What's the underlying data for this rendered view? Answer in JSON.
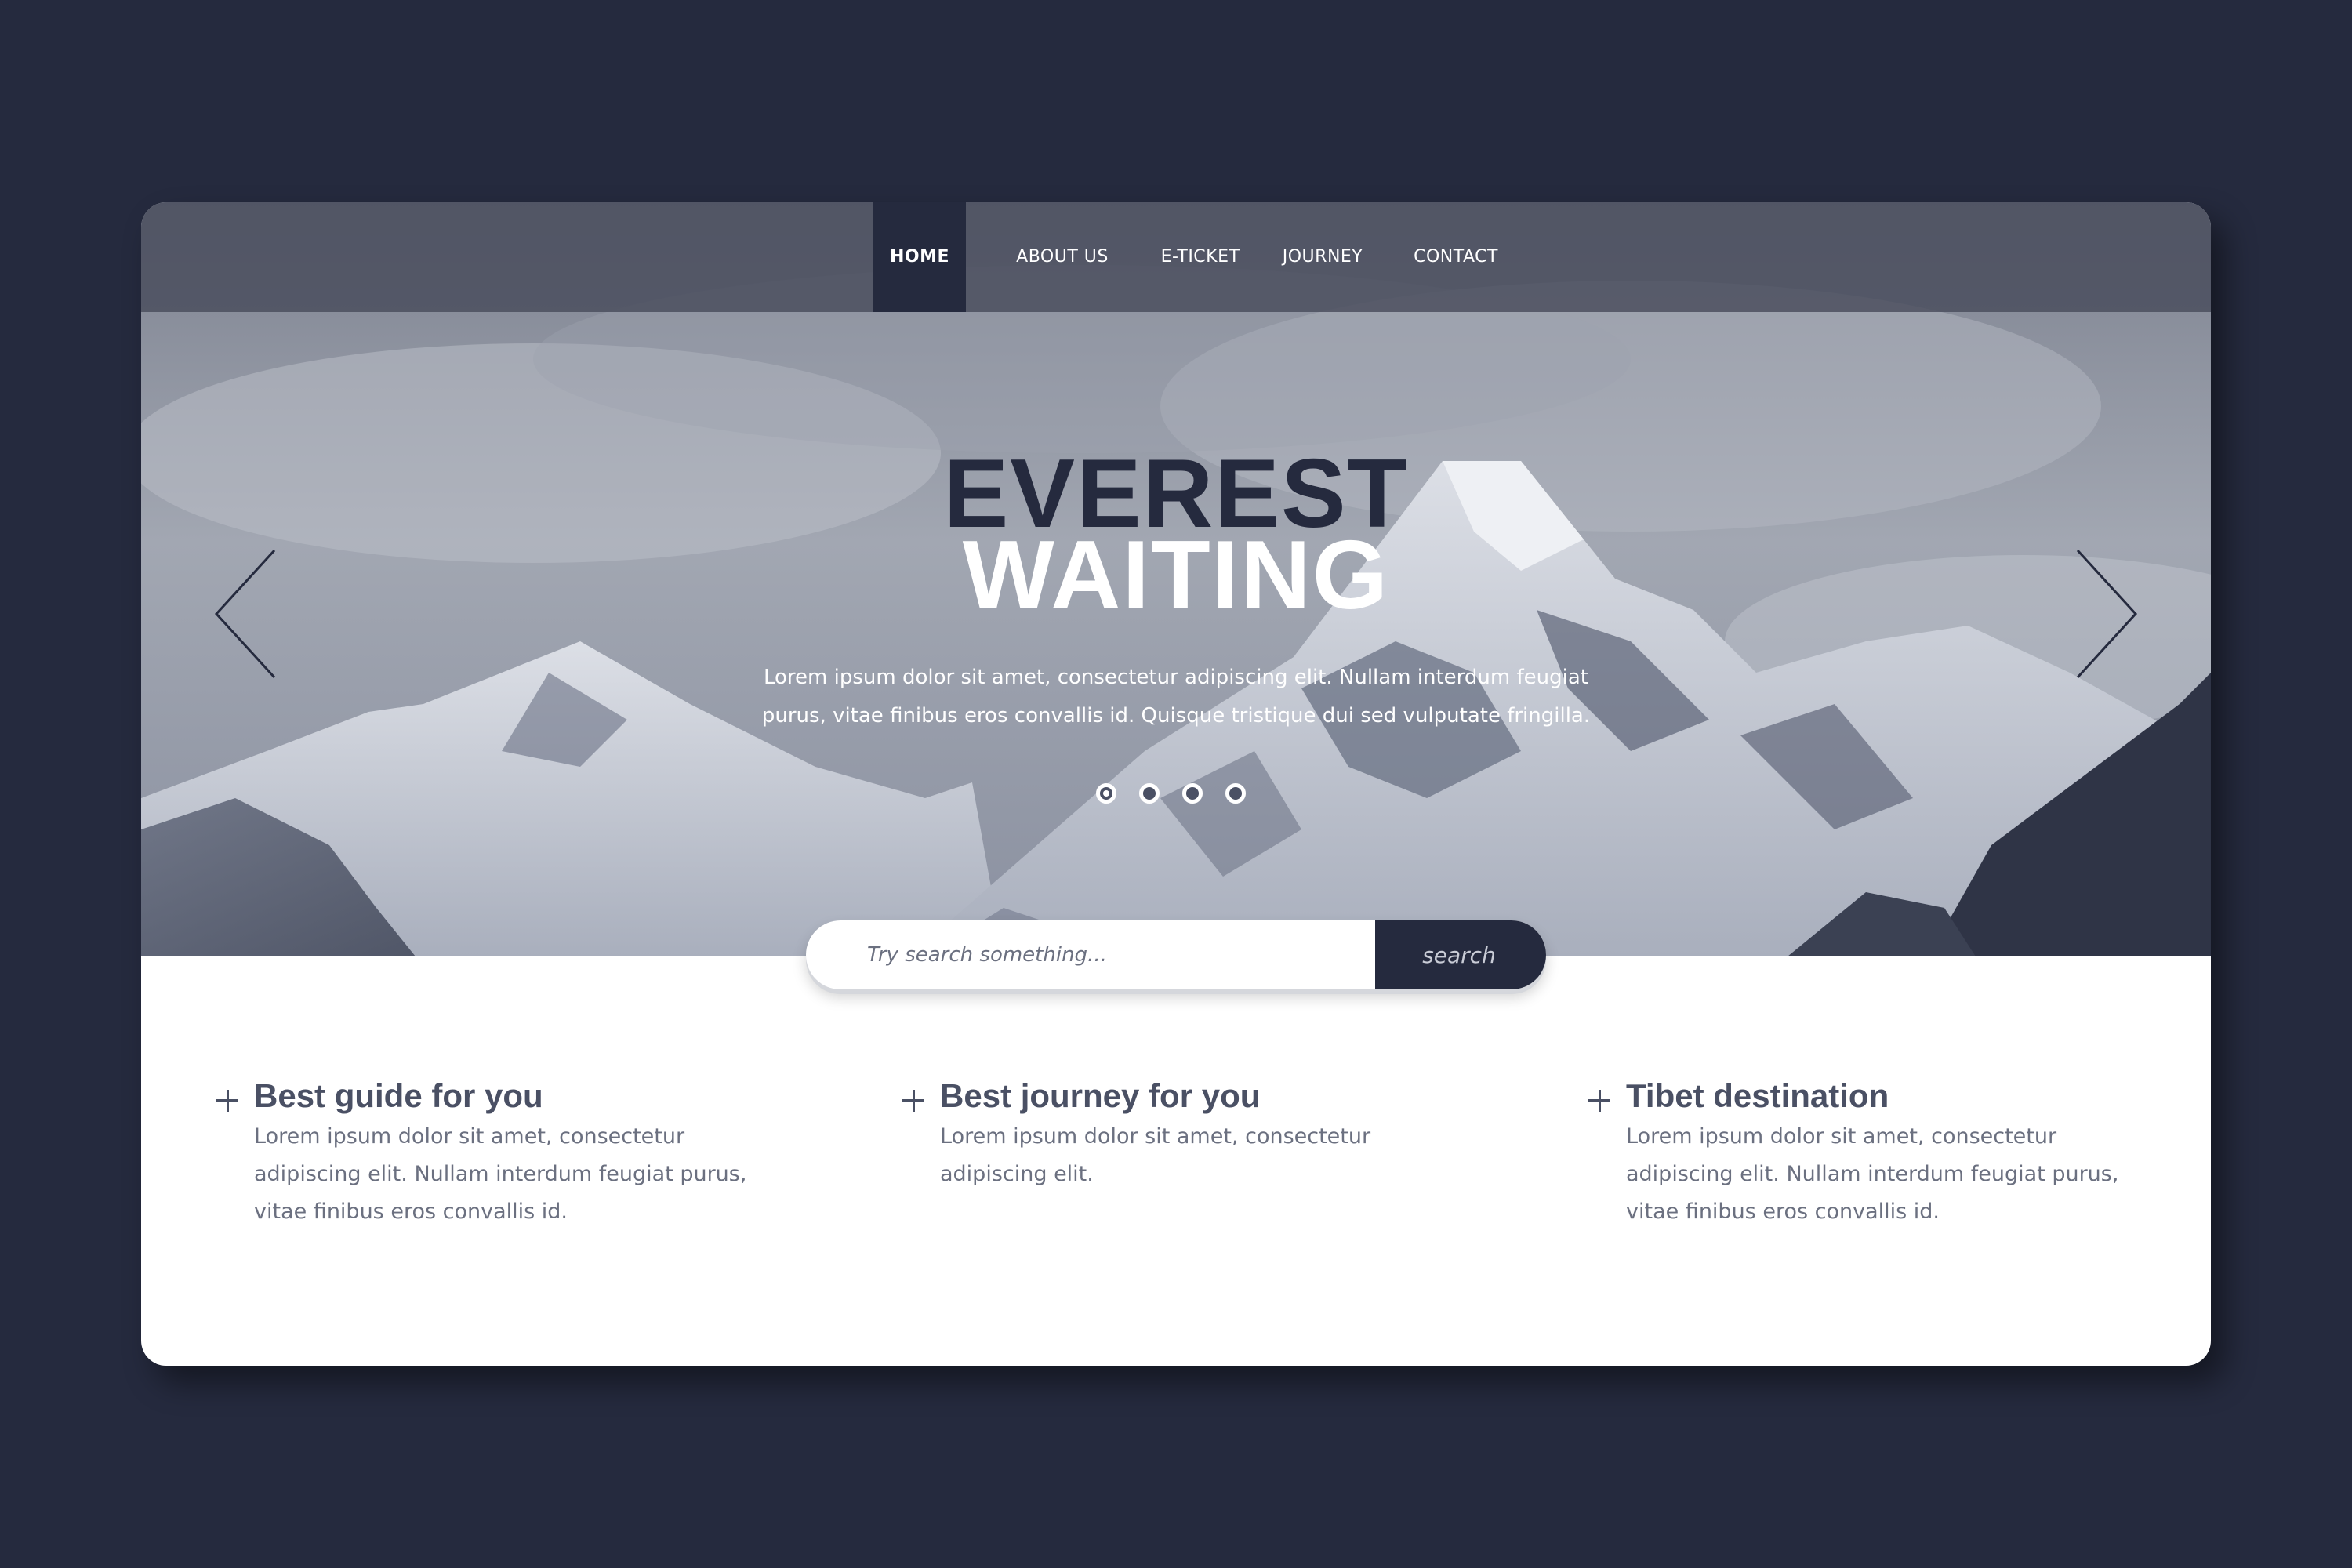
{
  "colors": {
    "page_background": "#252a3e",
    "accent_dark": "#252a3e",
    "nav_background": "#484c5c",
    "card_background": "#ffffff",
    "heading_text": "#4a5064",
    "body_text": "#6b7080"
  },
  "nav": {
    "items": [
      {
        "label": "HOME",
        "active": true
      },
      {
        "label": "ABOUT US",
        "active": false
      },
      {
        "label": "E-TICKET",
        "active": false
      },
      {
        "label": "JOURNEY",
        "active": false
      },
      {
        "label": "CONTACT",
        "active": false
      }
    ]
  },
  "hero": {
    "title_line_1": "EVEREST",
    "title_line_2": "WAITING",
    "description": "Lorem ipsum dolor sit amet, consectetur adipiscing elit. Nullam interdum feugiat purus, vitae finibus eros convallis id. Quisque tristique dui sed vulputate fringilla.",
    "prev_icon": "chevron-left-icon",
    "next_icon": "chevron-right-icon",
    "slide_count": 4,
    "active_slide": 1
  },
  "search": {
    "placeholder": "Try search something...",
    "value": "",
    "button_label": "search"
  },
  "features": [
    {
      "icon": "plus-icon",
      "title": "Best guide for you",
      "text": "Lorem ipsum dolor sit amet, consectetur adipiscing elit. Nullam interdum feugiat purus, vitae finibus eros convallis id."
    },
    {
      "icon": "plus-icon",
      "title": "Best journey for you",
      "text": "Lorem ipsum dolor sit amet, consectetur adipiscing elit."
    },
    {
      "icon": "plus-icon",
      "title": "Tibet destination",
      "text": "Lorem ipsum dolor sit amet, consectetur adipiscing elit. Nullam interdum feugiat purus, vitae finibus eros convallis id."
    }
  ]
}
